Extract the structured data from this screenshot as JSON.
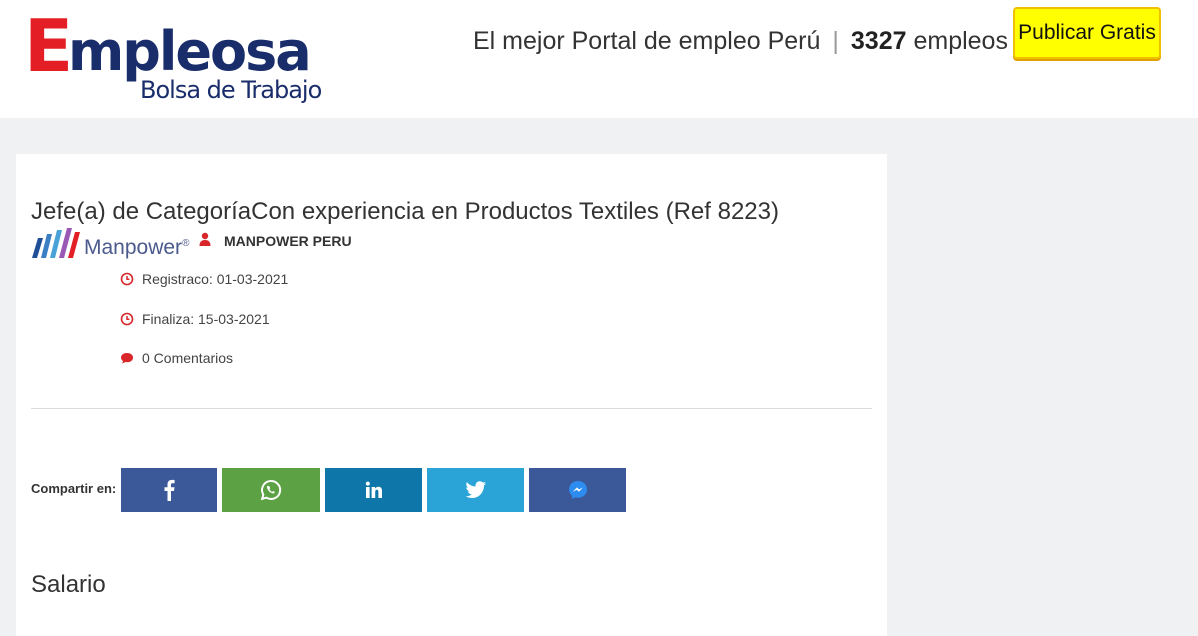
{
  "header": {
    "logo_letter": "E",
    "logo_rest": "mpleosa",
    "logo_sub": "Bolsa de Trabajo",
    "tagline": "El mejor Portal de empleo Perú",
    "separator": "|",
    "job_count": "3327",
    "job_count_suffix": "empleos",
    "publish_label": "Publicar Gratis"
  },
  "job": {
    "title": "Jefe(a) de CategoríaCon experiencia en Productos Textiles (Ref 8223)",
    "company_logo_text": "Manpower",
    "company_logo_mark": "®",
    "company": "MANPOWER PERU",
    "registered": "Registraco: 01-03-2021",
    "ends": "Finaliza: 15-03-2021",
    "comments": "0 Comentarios"
  },
  "share": {
    "label": "Compartir en:",
    "buttons": [
      {
        "name": "facebook",
        "icon": "facebook-icon",
        "color": "#3b5998"
      },
      {
        "name": "whatsapp",
        "icon": "whatsapp-icon",
        "color": "#5ca143"
      },
      {
        "name": "linkedin",
        "icon": "linkedin-icon",
        "color": "#0e76a8"
      },
      {
        "name": "twitter",
        "icon": "twitter-icon",
        "color": "#2aa3d6"
      },
      {
        "name": "messenger",
        "icon": "messenger-icon",
        "color": "#3b5998"
      }
    ]
  },
  "section": {
    "salary_heading": "Salario"
  },
  "colors": {
    "brand_red": "#e31e24",
    "brand_navy": "#1a2d6b",
    "accent_yellow": "#ffff00",
    "icon_red": "#d9262b"
  }
}
